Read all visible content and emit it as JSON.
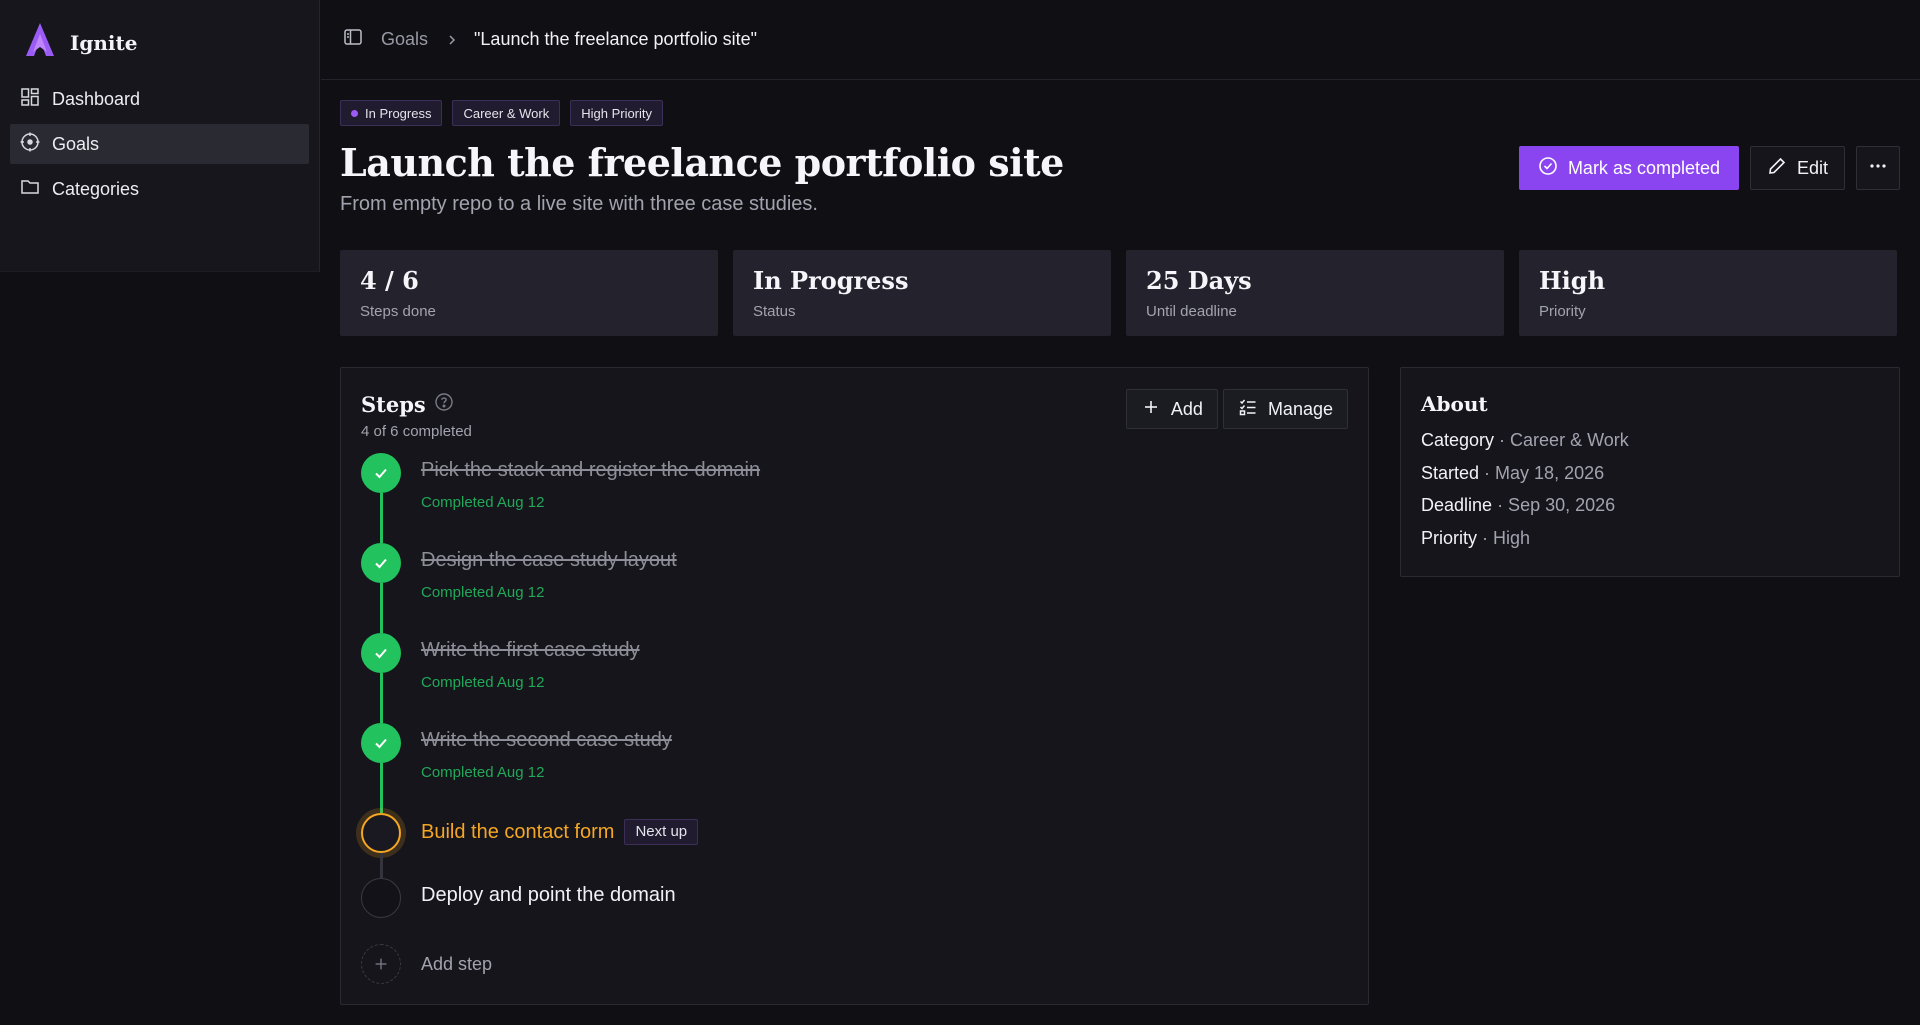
{
  "app": {
    "name": "Ignite"
  },
  "sidebar": {
    "items": [
      {
        "label": "Dashboard",
        "icon": "dashboard-icon"
      },
      {
        "label": "Goals",
        "icon": "target-icon",
        "active": true
      },
      {
        "label": "Categories",
        "icon": "folder-icon"
      }
    ]
  },
  "breadcrumb": {
    "parent": "Goals",
    "current": "\"Launch the freelance portfolio site\""
  },
  "goal": {
    "tags": [
      "In Progress",
      "Career & Work",
      "High Priority"
    ],
    "title": "Launch the freelance portfolio site",
    "subtitle": "From empty repo to a live site with three case studies."
  },
  "actions": {
    "complete": "Mark as completed",
    "edit": "Edit"
  },
  "stats": [
    {
      "value": "4 / 6",
      "label": "Steps done"
    },
    {
      "value": "In Progress",
      "label": "Status"
    },
    {
      "value": "25 Days",
      "label": "Until deadline"
    },
    {
      "value": "High",
      "label": "Priority"
    }
  ],
  "steps_panel": {
    "title": "Steps",
    "count": "4 of 6 completed",
    "add_label": "Add",
    "manage_label": "Manage",
    "add_step_label": "Add step",
    "next_badge": "Next up",
    "steps": [
      {
        "title": "Pick the stack and register the domain",
        "meta": "Completed Aug 12",
        "state": "done"
      },
      {
        "title": "Design the case study layout",
        "meta": "Completed Aug 12",
        "state": "done"
      },
      {
        "title": "Write the first case study",
        "meta": "Completed Aug 12",
        "state": "done"
      },
      {
        "title": "Write the second case study",
        "meta": "Completed Aug 12",
        "state": "done"
      },
      {
        "title": "Build the contact form",
        "meta": "",
        "state": "current"
      },
      {
        "title": "Deploy and point the domain",
        "meta": "",
        "state": "todo"
      }
    ]
  },
  "about": {
    "title": "About",
    "rows": [
      {
        "key": "Category",
        "value": " · Career & Work"
      },
      {
        "key": "Started",
        "value": " · May 18, 2026"
      },
      {
        "key": "Deadline",
        "value": " · Sep 30, 2026"
      },
      {
        "key": "Priority",
        "value": " · High"
      }
    ]
  },
  "colors": {
    "accent": "#8b45f0",
    "success": "#22c35e",
    "warning": "#f5a623",
    "background": "#0f0f14"
  }
}
